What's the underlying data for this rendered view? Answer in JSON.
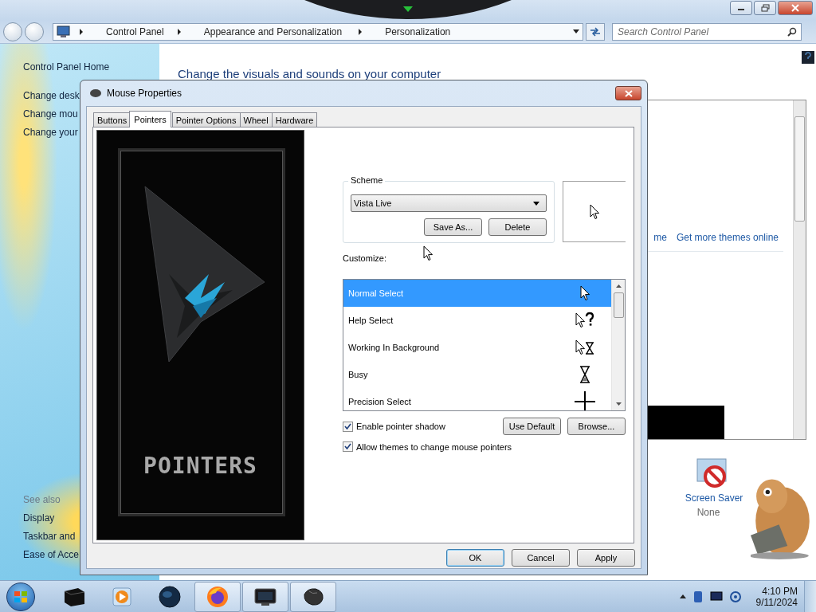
{
  "address_bar": {
    "breadcrumbs": [
      "Control Panel",
      "Appearance and Personalization",
      "Personalization"
    ],
    "search": {
      "placeholder": "Search Control Panel"
    }
  },
  "sidebar": {
    "links": [
      "Control Panel Home",
      "Change desk",
      "Change mou",
      "Change your"
    ],
    "see_also_heading": "See also",
    "see_also": [
      "Display",
      "Taskbar and",
      "Ease of Acce"
    ]
  },
  "content": {
    "heading": "Change the visuals and sounds on your computer",
    "links": [
      "me",
      "Get more themes online"
    ],
    "screen_saver": {
      "label": "Screen Saver",
      "value": "None"
    }
  },
  "dialog": {
    "title": "Mouse Properties",
    "tabs": [
      {
        "label": "Buttons",
        "selected": false
      },
      {
        "label": "Pointers",
        "selected": true
      },
      {
        "label": "Pointer Options",
        "selected": false
      },
      {
        "label": "Wheel",
        "selected": false
      },
      {
        "label": "Hardware",
        "selected": false
      }
    ],
    "art_title": "POINTERS",
    "scheme": {
      "legend": "Scheme",
      "value": "Vista Live",
      "buttons": [
        "Save As...",
        "Delete"
      ]
    },
    "customize_label": "Customize:",
    "cursors": [
      {
        "name": "Normal Select",
        "kind": "arrow",
        "selected": true
      },
      {
        "name": "Help Select",
        "kind": "help",
        "selected": false
      },
      {
        "name": "Working In Background",
        "kind": "working",
        "selected": false
      },
      {
        "name": "Busy",
        "kind": "busy",
        "selected": false
      },
      {
        "name": "Precision Select",
        "kind": "cross",
        "selected": false
      }
    ],
    "options": [
      {
        "label": "Enable pointer shadow",
        "checked": true
      },
      {
        "label": "Allow themes to change mouse pointers",
        "checked": true
      }
    ],
    "list_buttons": [
      "Use Default",
      "Browse..."
    ],
    "buttons": [
      {
        "label": "OK",
        "default": true
      },
      {
        "label": "Cancel",
        "default": false
      },
      {
        "label": "Apply",
        "default": false
      }
    ]
  },
  "taskbar": {
    "items": [
      {
        "kind": "box",
        "open": false
      },
      {
        "kind": "media",
        "open": false
      },
      {
        "kind": "globe",
        "open": false
      },
      {
        "kind": "firefox",
        "open": true
      },
      {
        "kind": "monitor",
        "open": true
      },
      {
        "kind": "mouse",
        "open": true
      }
    ],
    "time": "4:10 PM",
    "date": "9/11/2024"
  }
}
